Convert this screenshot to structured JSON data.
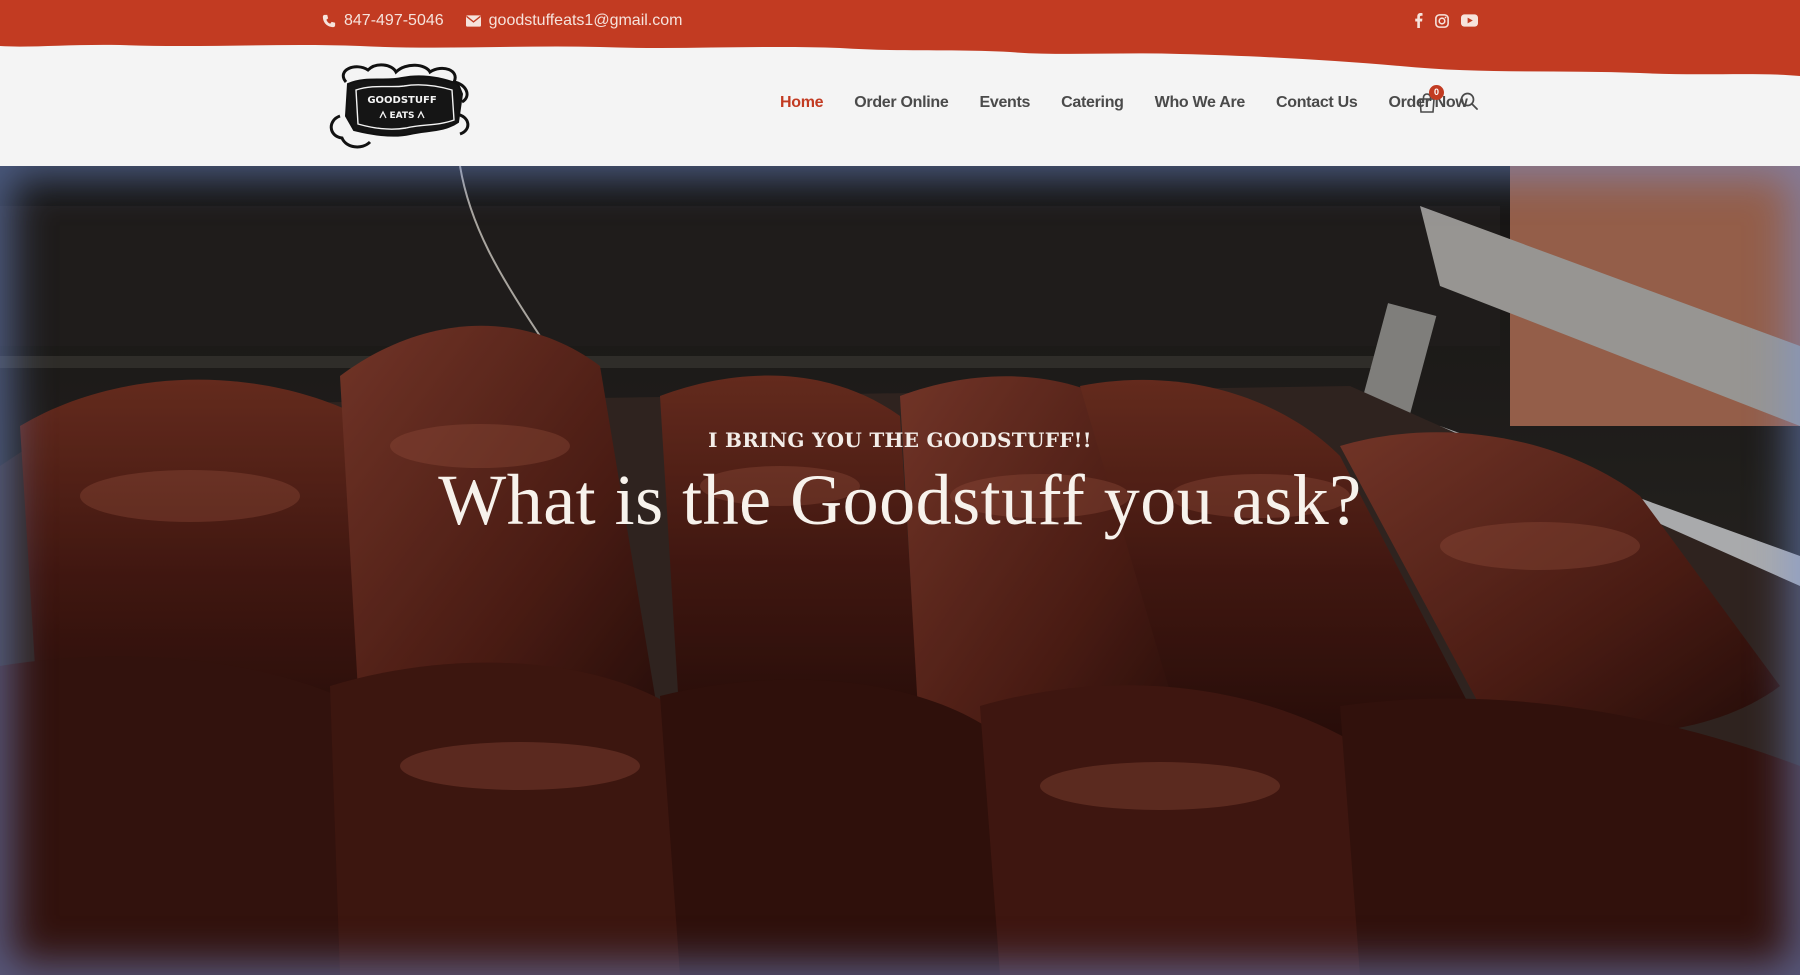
{
  "topbar": {
    "phone": "847-497-5046",
    "email": "goodstuffeats1@gmail.com",
    "background_color": "#c23b22",
    "social_icons": [
      "facebook-icon",
      "instagram-icon",
      "youtube-icon"
    ]
  },
  "logo": {
    "line1": "GOODSTUFF",
    "line2": "EATS"
  },
  "nav": {
    "items": [
      {
        "label": "Home",
        "active": true
      },
      {
        "label": "Order Online"
      },
      {
        "label": "Events"
      },
      {
        "label": "Catering"
      },
      {
        "label": "Who We Are"
      },
      {
        "label": "Contact Us"
      },
      {
        "label": "Order Now"
      }
    ],
    "cart_count": "0",
    "accent_color": "#c23b22"
  },
  "hero": {
    "eyebrow": "I BRING YOU THE GOODSTUFF!!",
    "title": "What is the Goodstuff you ask?"
  }
}
